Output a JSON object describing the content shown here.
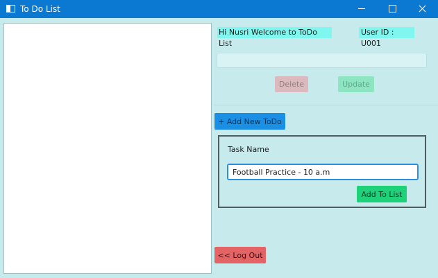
{
  "window": {
    "title": "To Do List"
  },
  "header": {
    "welcome_text": "Hi Nusri Welcome to ToDo List",
    "user_id_text": "User ID : U001"
  },
  "selected_task": {
    "value": ""
  },
  "actions": {
    "delete_label": "Delete",
    "update_label": "Update",
    "add_new_label": "+ Add New ToDo",
    "logout_label": "<< Log Out"
  },
  "new_task": {
    "label": "Task Name",
    "value": "Football Practice - 10 a.m",
    "add_label": "Add To List"
  },
  "todo_items": [],
  "colors": {
    "titlebar": "#0b78d2",
    "background": "#c7eaec",
    "info_highlight": "#7ff7ef",
    "add_new_button": "#1a8fe3",
    "add_list_button": "#1fd27a",
    "logout_button": "#e46466",
    "delete_button_disabled": "#dbb9bd",
    "update_button_disabled": "#8ee5c2"
  },
  "icons": {
    "app": "app-window-icon",
    "minimize": "minimize-icon",
    "maximize": "maximize-icon",
    "close": "close-icon"
  }
}
